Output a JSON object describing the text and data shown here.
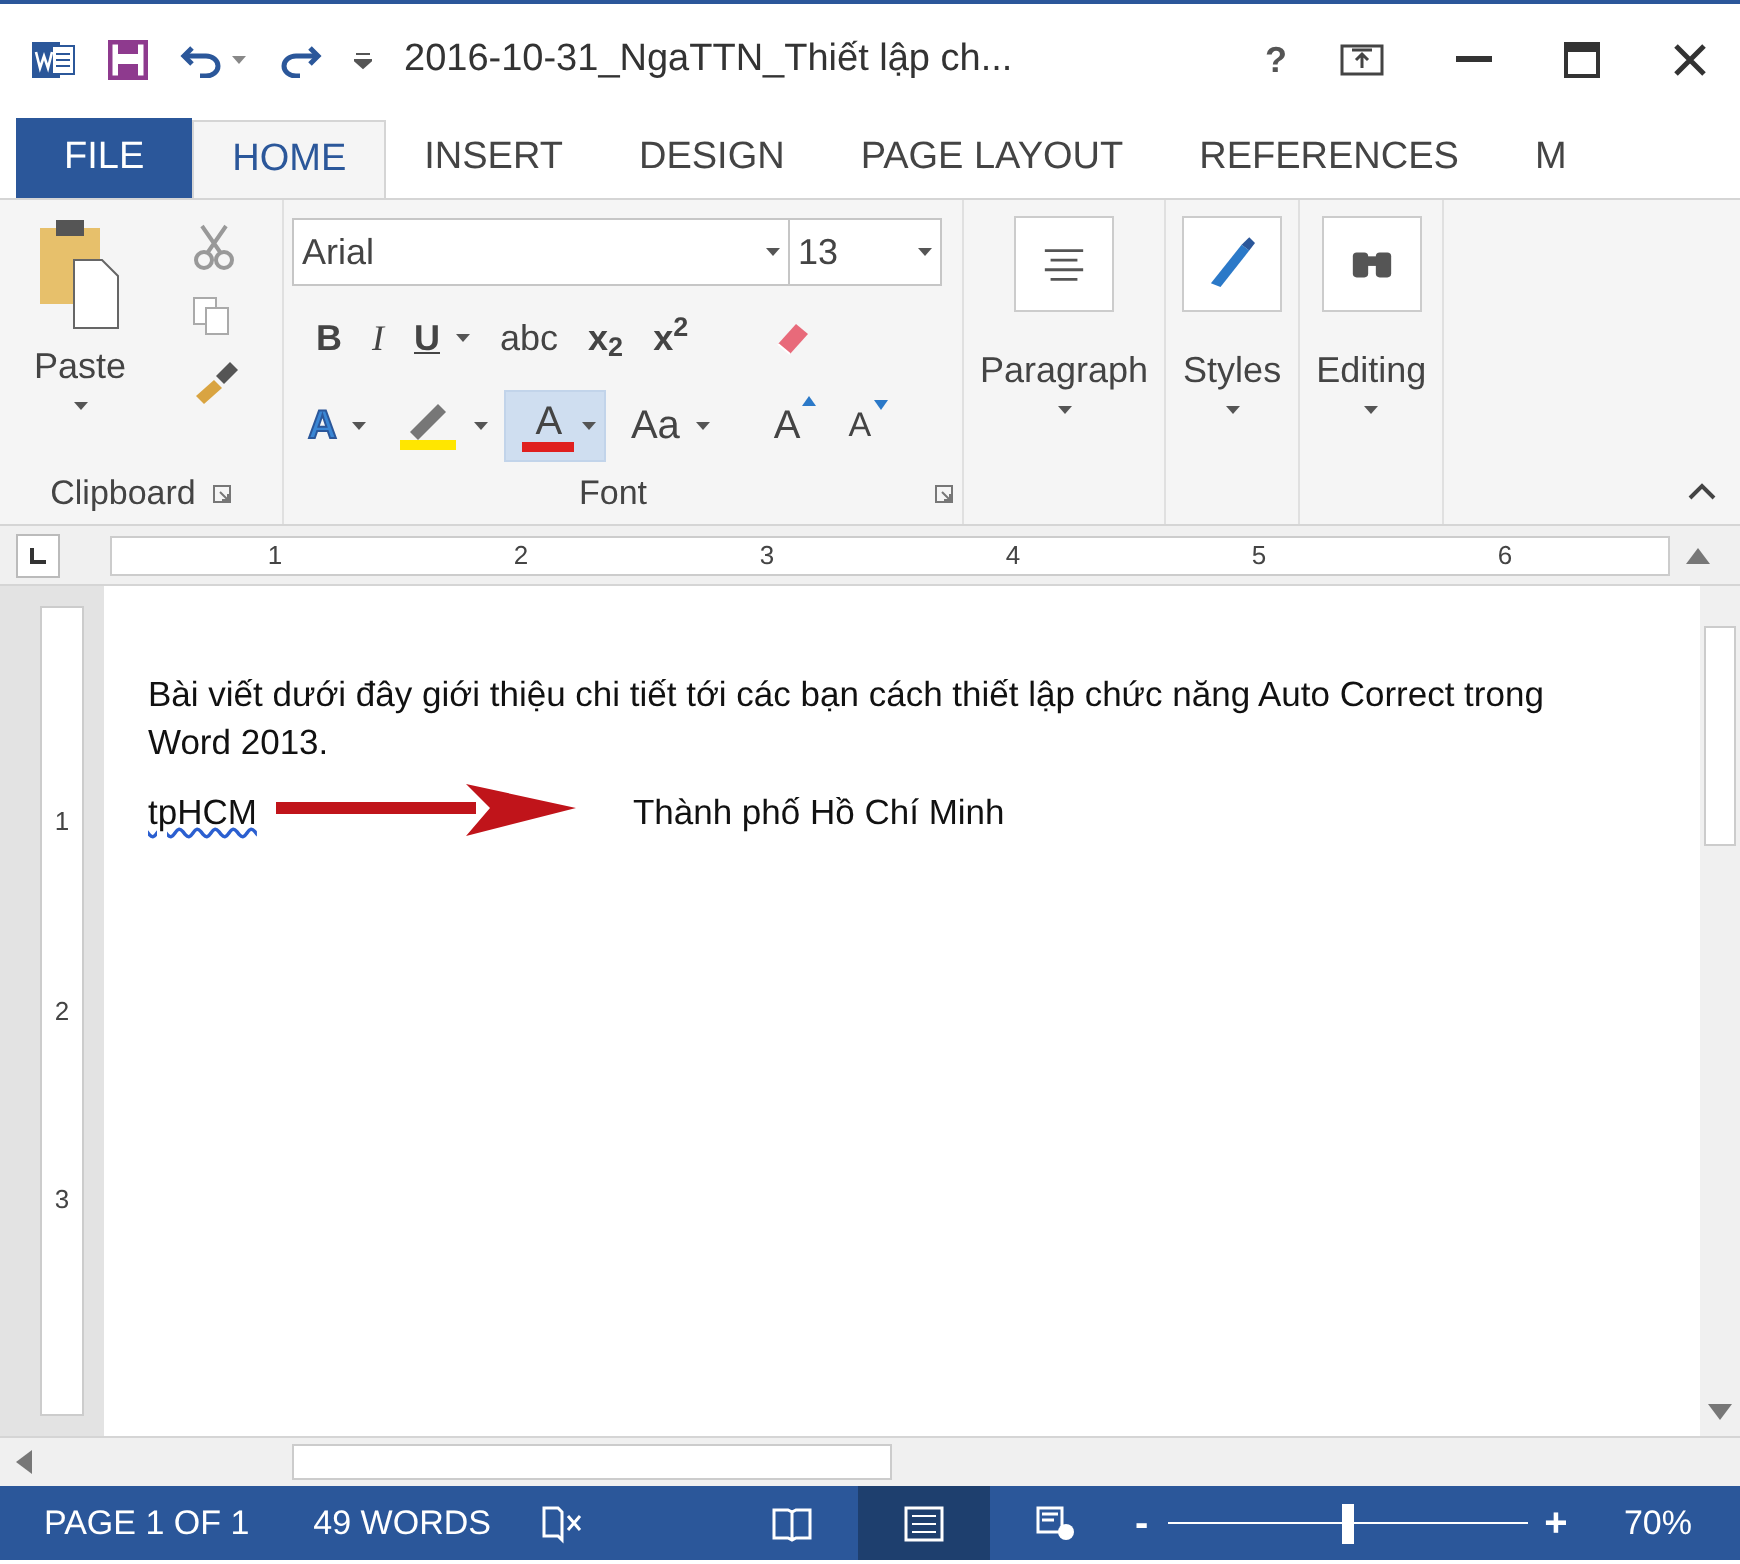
{
  "title_bar": {
    "title": "2016-10-31_NgaTTN_Thiết lập ch...",
    "help": "?"
  },
  "tabs": [
    {
      "label": "FILE",
      "selected": false,
      "kind": "file"
    },
    {
      "label": "HOME",
      "selected": true,
      "kind": "tab"
    },
    {
      "label": "INSERT",
      "selected": false,
      "kind": "tab"
    },
    {
      "label": "DESIGN",
      "selected": false,
      "kind": "tab"
    },
    {
      "label": "PAGE LAYOUT",
      "selected": false,
      "kind": "tab"
    },
    {
      "label": "REFERENCES",
      "selected": false,
      "kind": "tab"
    },
    {
      "label": "M",
      "selected": false,
      "kind": "tab"
    }
  ],
  "clipboard": {
    "paste": "Paste",
    "label": "Clipboard"
  },
  "font": {
    "name": "Arial",
    "size": "13",
    "label": "Font",
    "row1": [
      {
        "kind": "bold",
        "text": "B"
      },
      {
        "kind": "italic",
        "text": "I"
      },
      {
        "kind": "underline",
        "text": "U",
        "dropdown": true
      },
      {
        "kind": "strike",
        "text": "abc"
      },
      {
        "kind": "plain",
        "text": "x$_{2}$"
      },
      {
        "kind": "plain",
        "text": "x$^{2}$"
      }
    ],
    "effects": "A",
    "font_color": {
      "text": "A",
      "selected": true
    },
    "change_case": "Aa",
    "grow": "A",
    "shrink": "A"
  },
  "groups": [
    {
      "label": "Paragraph",
      "kind": "paragraph"
    },
    {
      "label": "Styles",
      "kind": "styles"
    },
    {
      "label": "Editing",
      "kind": "editing"
    }
  ],
  "ruler": {
    "numbers": [
      "1",
      "2",
      "3",
      "4",
      "5",
      "6"
    ]
  },
  "vertical_ruler": {
    "numbers": [
      "1",
      "2",
      "3"
    ]
  },
  "document": {
    "paragraph": "Bài viết dưới đây giới thiệu chi tiết tới các bạn cách thiết lập chức năng Auto Correct trong Word 2013.",
    "misspelled_word": {
      "text": "tpHCM",
      "misspelled": true
    },
    "replacement": "Thành phố Hồ Chí Minh"
  },
  "status_bar": {
    "page": "PAGE 1 OF 1",
    "words": "49 WORDS",
    "views": [
      {
        "kind": "read",
        "selected": false
      },
      {
        "kind": "print",
        "selected": true
      },
      {
        "kind": "web",
        "selected": false
      }
    ],
    "zoom_minus": "-",
    "zoom_plus": "+",
    "zoom": {
      "level": 0.5
    },
    "zoom_text": "70%"
  }
}
